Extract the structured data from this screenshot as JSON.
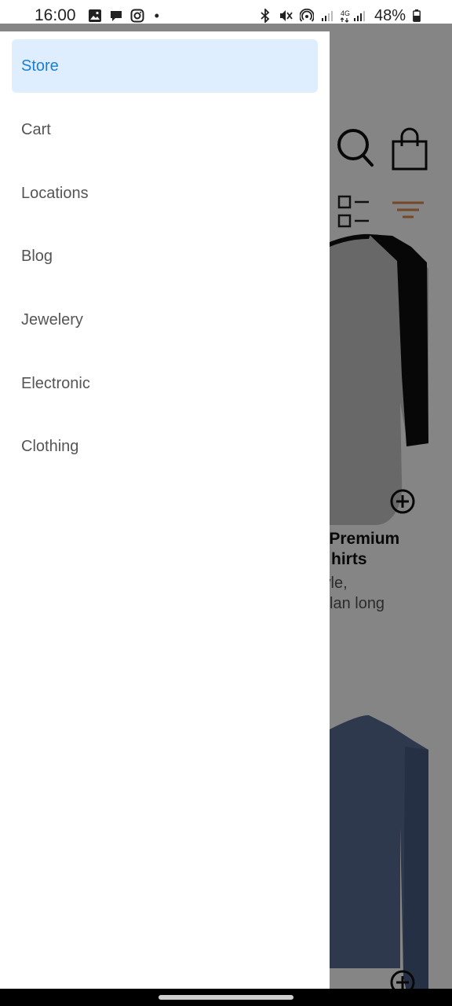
{
  "status_bar": {
    "time": "16:00",
    "battery": "48%",
    "left_icons": [
      "gallery-icon",
      "chat-bubble-icon",
      "instagram-icon"
    ],
    "right_icons": [
      "bluetooth-icon",
      "mute-icon",
      "hotspot-icon",
      "signal-icon",
      "4g-signal-icon",
      "battery-icon"
    ]
  },
  "drawer": {
    "items": [
      {
        "label": "Store",
        "active": true
      },
      {
        "label": "Cart",
        "active": false
      },
      {
        "label": "Locations",
        "active": false
      },
      {
        "label": "Blog",
        "active": false
      },
      {
        "label": "Jewelery",
        "active": false
      },
      {
        "label": "Electronic",
        "active": false
      },
      {
        "label": "Clothing",
        "active": false
      }
    ]
  },
  "background": {
    "product_1": {
      "title_line1": "al Premium",
      "title_line2": "hirts",
      "desc_line1": "style,",
      "desc_line2": "lan long"
    }
  },
  "colors": {
    "active_bg": "#deeefe",
    "active_text": "#1a7fd4",
    "filter_accent": "#e08a50"
  }
}
